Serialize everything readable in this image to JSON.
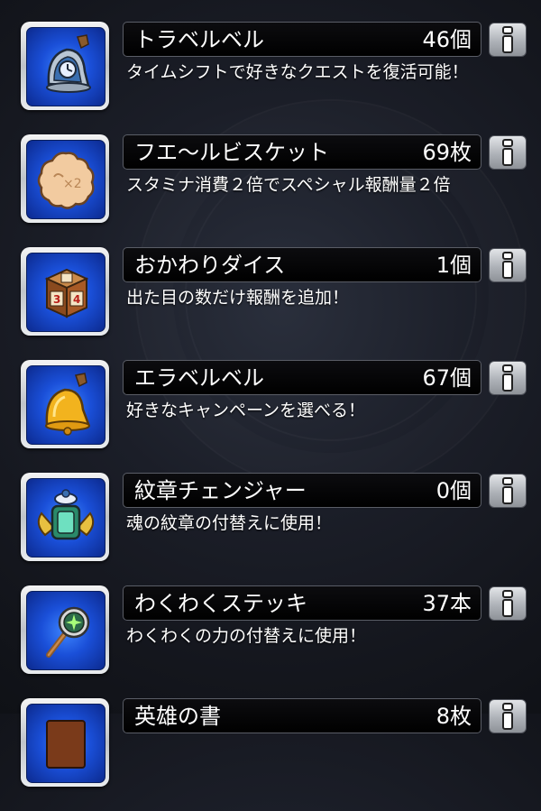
{
  "items": [
    {
      "name": "トラベルベル",
      "count": "46個",
      "description": "タイムシフトで好きなクエストを復活可能！",
      "icon": "bell-clock-icon"
    },
    {
      "name": "フエ〜ルビスケット",
      "count": "69枚",
      "description": "スタミナ消費２倍でスペシャル報酬量２倍",
      "icon": "biscuit-icon"
    },
    {
      "name": "おかわりダイス",
      "count": "1個",
      "description": "出た目の数だけ報酬を追加！",
      "icon": "dice-icon"
    },
    {
      "name": "エラベルベル",
      "count": "67個",
      "description": "好きなキャンペーンを選べる！",
      "icon": "gold-bell-icon"
    },
    {
      "name": "紋章チェンジャー",
      "count": "0個",
      "description": "魂の紋章の付替えに使用！",
      "icon": "emblem-changer-icon"
    },
    {
      "name": "わくわくステッキ",
      "count": "37本",
      "description": "わくわくの力の付替えに使用！",
      "icon": "magic-wand-icon"
    },
    {
      "name": "英雄の書",
      "count": "8枚",
      "description": "",
      "icon": "book-icon"
    }
  ],
  "info_button_icon": "info-icon"
}
